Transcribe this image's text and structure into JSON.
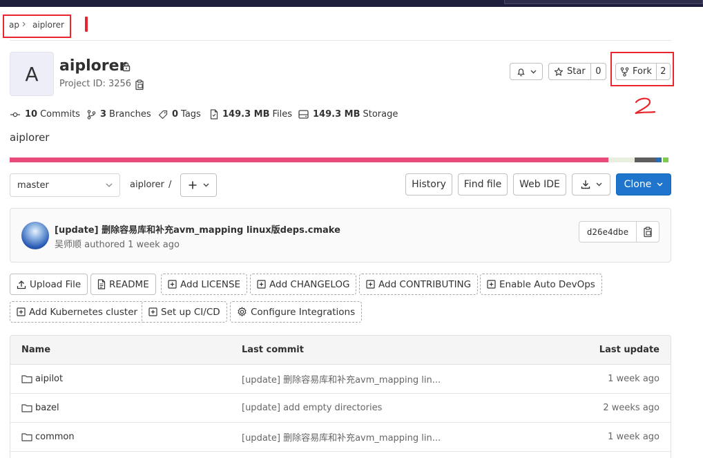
{
  "breadcrumb": {
    "group": "ap",
    "project": "aiplorer"
  },
  "annotations": {
    "mark_one": "1",
    "mark_two": "2"
  },
  "project": {
    "avatar_letter": "A",
    "name": "aiplorer",
    "id_label": "Project ID: 3256",
    "description": "aiplorer"
  },
  "actions": {
    "star_label": "Star",
    "star_count": "0",
    "fork_label": "Fork",
    "fork_count": "2"
  },
  "stats": [
    {
      "count": "10",
      "label": "Commits",
      "icon": "commit-icon"
    },
    {
      "count": "3",
      "label": "Branches",
      "icon": "branch-icon"
    },
    {
      "count": "0",
      "label": "Tags",
      "icon": "tag-icon"
    },
    {
      "count": "149.3 MB",
      "label": "Files",
      "icon": "file-icon"
    },
    {
      "count": "149.3 MB",
      "label": "Storage",
      "icon": "storage-icon"
    }
  ],
  "language_bar_colors": [
    "#e84a7c",
    "#e9efdf",
    "#5e5e5e",
    "#2b6cb0",
    "#7fcb52"
  ],
  "repo_toolbar": {
    "branch": "master",
    "path": "aiplorer",
    "path_sep": "/",
    "history": "History",
    "find_file": "Find file",
    "web_ide": "Web IDE",
    "clone": "Clone"
  },
  "last_commit": {
    "message": "[update] 删除容易库和补充avm_mapping linux版deps.cmake",
    "author": "吴师顺",
    "authored_text": "authored 1 week ago",
    "sha": "d26e4dbe"
  },
  "quick_actions": [
    {
      "label": "Upload File",
      "icon": "upload-icon",
      "style": "solid"
    },
    {
      "label": "README",
      "icon": "document-icon",
      "style": "solid"
    },
    {
      "label": "Add LICENSE",
      "icon": "plus-square-icon",
      "style": "dashed"
    },
    {
      "label": "Add CHANGELOG",
      "icon": "plus-square-icon",
      "style": "dashed"
    },
    {
      "label": "Add CONTRIBUTING",
      "icon": "plus-square-icon",
      "style": "dashed"
    },
    {
      "label": "Enable Auto DevOps",
      "icon": "plus-square-icon",
      "style": "dashed"
    },
    {
      "label": "Add Kubernetes cluster",
      "icon": "plus-square-icon",
      "style": "dashed"
    },
    {
      "label": "Set up CI/CD",
      "icon": "plus-square-icon",
      "style": "dashed"
    },
    {
      "label": "Configure Integrations",
      "icon": "gear-icon",
      "style": "dashed"
    }
  ],
  "file_table": {
    "headers": {
      "name": "Name",
      "last_commit": "Last commit",
      "last_update": "Last update"
    },
    "rows": [
      {
        "name": "aipilot",
        "commit": "[update] 删除容易库和补充avm_mapping lin...",
        "date": "1 week ago"
      },
      {
        "name": "bazel",
        "commit": "[update] add empty directories",
        "date": "2 weeks ago"
      },
      {
        "name": "common",
        "commit": "[update] 删除容易库和补充avm_mapping lin...",
        "date": "1 week ago"
      }
    ]
  }
}
